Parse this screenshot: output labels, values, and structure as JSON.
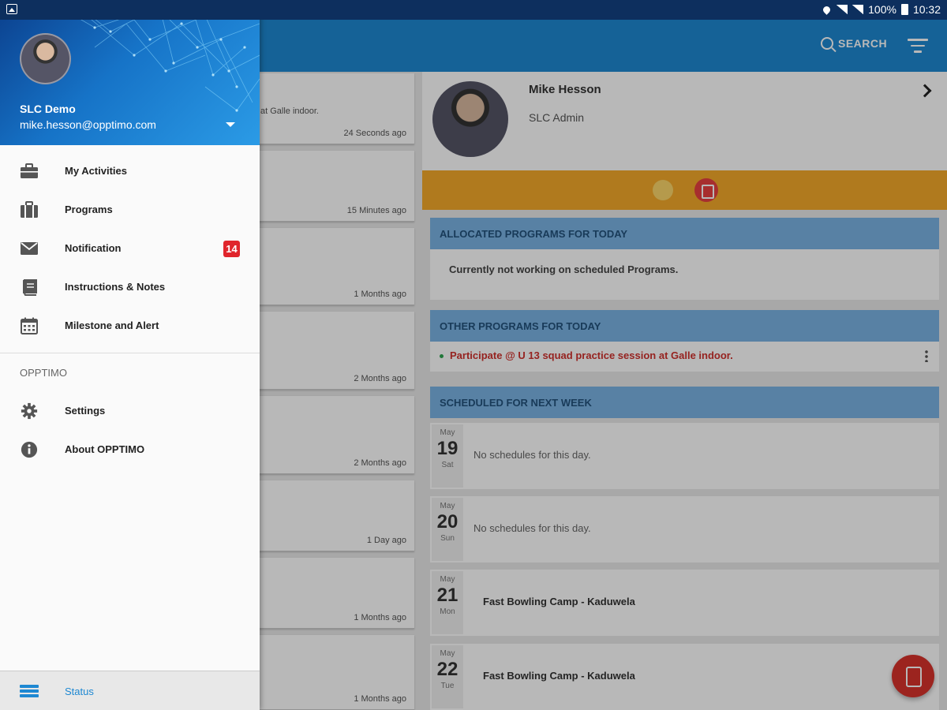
{
  "statusbar": {
    "battery": "100%",
    "time": "10:32"
  },
  "appbar": {
    "search_label": "SEARCH"
  },
  "activity_list": {
    "items": [
      {
        "snippet": "at Galle indoor.",
        "time": "24 Seconds ago"
      },
      {
        "time": "15 Minutes ago"
      },
      {
        "time": "1 Months ago"
      },
      {
        "time": "2 Months ago"
      },
      {
        "time": "2 Months ago"
      },
      {
        "time": "1 Day ago"
      },
      {
        "time": "1 Months ago"
      },
      {
        "time": "1 Months ago"
      }
    ]
  },
  "profile": {
    "name": "Mike Hesson",
    "role": "SLC Admin"
  },
  "sections": {
    "allocated": {
      "title": "ALLOCATED PROGRAMS FOR TODAY",
      "message": "Currently not working on scheduled Programs."
    },
    "other": {
      "title": "OTHER PROGRAMS FOR TODAY",
      "item": "Participate @ U 13 squad practice session at Galle indoor."
    },
    "next_week": {
      "title": "SCHEDULED FOR NEXT WEEK",
      "days": [
        {
          "month": "May",
          "day": "19",
          "weekday": "Sat",
          "text": "No schedules for this day."
        },
        {
          "month": "May",
          "day": "20",
          "weekday": "Sun",
          "text": "No schedules for this day."
        },
        {
          "month": "May",
          "day": "21",
          "weekday": "Mon",
          "text": "Fast Bowling Camp - Kaduwela"
        },
        {
          "month": "May",
          "day": "22",
          "weekday": "Tue",
          "text": "Fast Bowling Camp - Kaduwela"
        }
      ]
    }
  },
  "drawer": {
    "account_name": "SLC Demo",
    "account_email": "mike.hesson@opptimo.com",
    "menu": [
      {
        "label": "My Activities",
        "icon": "briefcase-icon"
      },
      {
        "label": "Programs",
        "icon": "luggage-icon"
      },
      {
        "label": "Notification",
        "icon": "envelope-icon",
        "badge": "14"
      },
      {
        "label": "Instructions & Notes",
        "icon": "book-icon"
      },
      {
        "label": "Milestone and Alert",
        "icon": "calendar-icon"
      }
    ],
    "section_title": "OPPTIMO",
    "secondary": [
      {
        "label": "Settings",
        "icon": "gear-icon"
      },
      {
        "label": "About OPPTIMO",
        "icon": "info-icon"
      }
    ],
    "footer": {
      "label": "Status",
      "icon": "status-icon"
    }
  },
  "colors": {
    "primary": "#1e88d2",
    "status_bar": "#0d2f5e",
    "accent_orange": "#f4a92a",
    "badge_red": "#e0252c",
    "section_header": "#7ab3e4"
  }
}
